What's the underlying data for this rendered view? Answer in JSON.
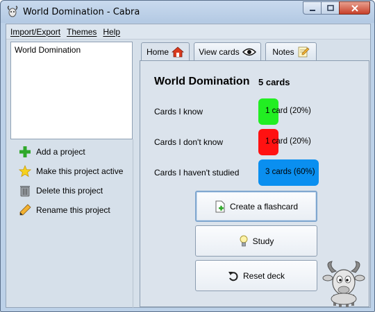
{
  "window": {
    "title": "World Domination - Cabra"
  },
  "menu": [
    {
      "label": "Import/Export"
    },
    {
      "label": "Themes"
    },
    {
      "label": "Help"
    }
  ],
  "projects": {
    "items": [
      "World Domination"
    ]
  },
  "actions": [
    {
      "label": "Add a project",
      "icon": "plus-icon"
    },
    {
      "label": "Make this project active",
      "icon": "star-icon"
    },
    {
      "label": "Delete this project",
      "icon": "trash-icon"
    },
    {
      "label": "Rename this project",
      "icon": "pencil-icon"
    }
  ],
  "tabs": [
    {
      "label": "Home",
      "icon": "home-icon",
      "active": true
    },
    {
      "label": "View cards",
      "icon": "eye-icon",
      "active": false
    },
    {
      "label": "Notes",
      "icon": "notepad-icon",
      "active": false
    }
  ],
  "deck": {
    "name": "World Domination",
    "count_label": "5 cards"
  },
  "stats": [
    {
      "label": "Cards I know",
      "value_label": "1 card (20%)",
      "fraction": 0.2,
      "color": "#22ee22"
    },
    {
      "label": "Cards I don't know",
      "value_label": "1 card (20%)",
      "fraction": 0.2,
      "color": "#ff1111"
    },
    {
      "label": "Cards I haven't studied",
      "value_label": "3 cards (60%)",
      "fraction": 0.6,
      "color": "#0a8ff0"
    }
  ],
  "buttons": {
    "create": "Create a flashcard",
    "study": "Study",
    "reset": "Reset deck"
  }
}
